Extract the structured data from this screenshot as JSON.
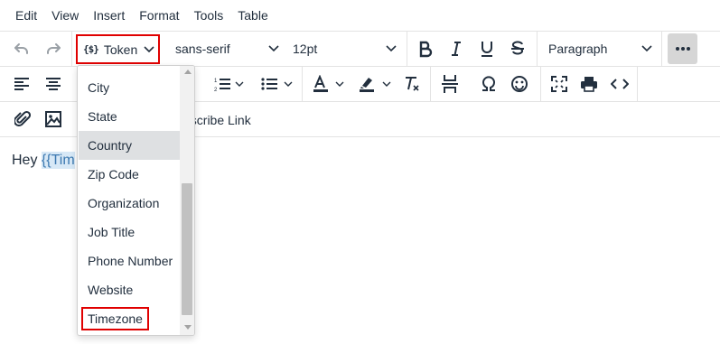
{
  "menubar": {
    "items": [
      "Edit",
      "View",
      "Insert",
      "Format",
      "Tools",
      "Table"
    ]
  },
  "toolbar": {
    "token_label": "Token",
    "token_icon": "{$}",
    "font_family": "sans-serif",
    "font_size": "12pt",
    "block_format": "Paragraph",
    "unsubscribe_label": "bscribe Link"
  },
  "editor": {
    "prefix": "Hey ",
    "token_text": "{{Tim"
  },
  "dropdown": {
    "items": [
      "City",
      "State",
      "Country",
      "Zip Code",
      "Organization",
      "Job Title",
      "Phone Number",
      "Website",
      "Timezone"
    ],
    "active_item": "Country",
    "highlighted_item": "Timezone"
  },
  "colors": {
    "text": "#222f3e",
    "highlight_border": "#e00000",
    "active_bg": "#dee0e2",
    "token_bg": "#d7e8f6"
  }
}
